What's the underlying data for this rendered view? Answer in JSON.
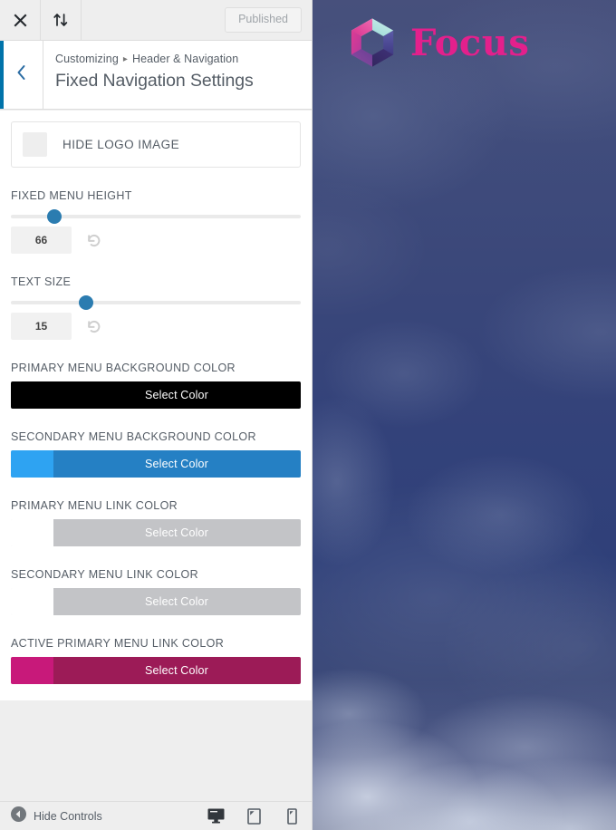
{
  "topbar": {
    "close_label": "Close",
    "collapse_label": "Collapse sidebar",
    "publish_label": "Published"
  },
  "section_header": {
    "back_label": "Back",
    "breadcrumb_root": "Customizing",
    "breadcrumb_separator": "▸",
    "breadcrumb_parent": "Header & Navigation",
    "title": "Fixed Navigation Settings"
  },
  "controls": {
    "hide_logo": {
      "label": "HIDE LOGO IMAGE",
      "checked": false
    },
    "fixed_menu_height": {
      "label": "FIXED MENU HEIGHT",
      "value": "66",
      "handle_percent": "15%",
      "reset_label": "Reset"
    },
    "text_size": {
      "label": "TEXT SIZE",
      "value": "15",
      "handle_percent": "26%",
      "reset_label": "Reset"
    },
    "primary_menu_bg": {
      "label": "PRIMARY MENU BACKGROUND COLOR",
      "button_label": "Select Color",
      "swatch_color": "#000000",
      "body_color": "#000000"
    },
    "secondary_menu_bg": {
      "label": "SECONDARY MENU BACKGROUND COLOR",
      "button_label": "Select Color",
      "swatch_color": "#2ea3f2",
      "body_color": "#2580c4"
    },
    "primary_menu_link": {
      "label": "PRIMARY MENU LINK COLOR",
      "button_label": "Select Color",
      "swatch_color": "#ffffff",
      "body_color": "#c3c4c7"
    },
    "secondary_menu_link": {
      "label": "SECONDARY MENU LINK COLOR",
      "button_label": "Select Color",
      "swatch_color": "#ffffff",
      "body_color": "#c3c4c7"
    },
    "active_primary_menu_link": {
      "label": "ACTIVE PRIMARY MENU LINK COLOR",
      "button_label": "Select Color",
      "swatch_color": "#c8197a",
      "body_color": "#9c1b57"
    }
  },
  "bottombar": {
    "hide_controls_label": "Hide Controls",
    "devices": [
      {
        "name": "desktop",
        "active": true
      },
      {
        "name": "tablet",
        "active": false
      },
      {
        "name": "mobile",
        "active": false
      }
    ]
  },
  "preview": {
    "brand_name": "Focus",
    "brand_color": "#e3208c",
    "logo_colors": {
      "top_left": "#e8509b",
      "top_right": "#9fdcd8",
      "right": "#4a4a96",
      "bottom_right": "#3c2f72",
      "bottom": "#5d3b8e",
      "left": "#d0399c"
    }
  }
}
